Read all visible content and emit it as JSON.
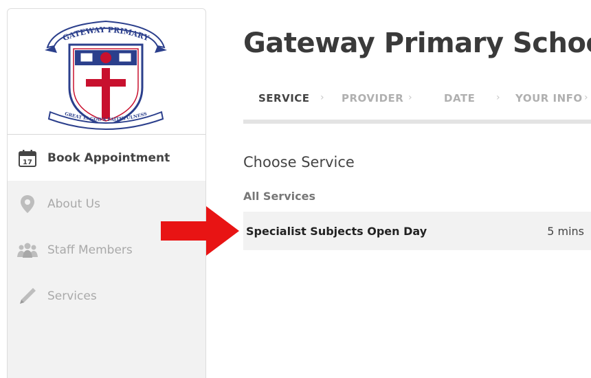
{
  "logo": {
    "banner_top": "GATEWAY PRIMARY",
    "banner_bottom": "GREAT IS GOD'S FAITHFULNESS"
  },
  "sidebar": {
    "items": [
      {
        "label": "Book Appointment",
        "icon": "calendar-icon",
        "calendar_day": "17",
        "active": true
      },
      {
        "label": "About Us",
        "icon": "location-pin-icon",
        "active": false
      },
      {
        "label": "Staff Members",
        "icon": "people-icon",
        "active": false
      },
      {
        "label": "Services",
        "icon": "pencil-icon",
        "active": false
      }
    ]
  },
  "main": {
    "title": "Gateway Primary School",
    "steps": [
      {
        "label": "SERVICE",
        "active": true
      },
      {
        "label": "PROVIDER",
        "active": false
      },
      {
        "label": "DATE",
        "active": false
      },
      {
        "label": "YOUR INFO",
        "active": false
      }
    ],
    "step_separator": "›",
    "choose_heading": "Choose Service",
    "group_heading": "All Services",
    "services": [
      {
        "name": "Specialist Subjects Open Day",
        "duration": "5 mins"
      }
    ]
  },
  "colors": {
    "sidebar_bg": "#f2f2f2",
    "active_item_bg": "#ffffff",
    "crest_red": "#c8102e",
    "arrow_red": "#e81414",
    "crest_blue": "#2b3f8c"
  }
}
